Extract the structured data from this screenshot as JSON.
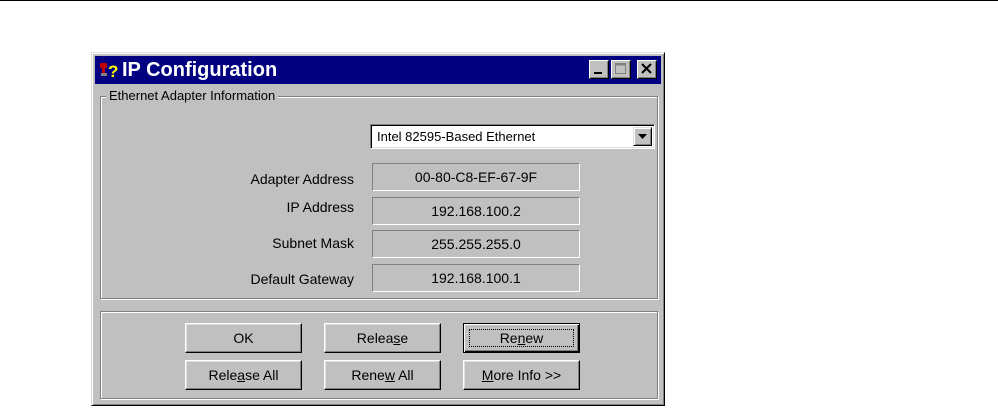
{
  "window": {
    "title": "IP Configuration"
  },
  "group": {
    "legend": "Ethernet  Adapter Information"
  },
  "adapter_select": {
    "selected": "Intel 82595-Based Ethernet"
  },
  "fields": {
    "adapter_address": {
      "label": "Adapter Address",
      "value": "00-80-C8-EF-67-9F"
    },
    "ip_address": {
      "label": "IP Address",
      "value": "192.168.100.2"
    },
    "subnet_mask": {
      "label": "Subnet Mask",
      "value": "255.255.255.0"
    },
    "default_gateway": {
      "label": "Default Gateway",
      "value": "192.168.100.1"
    }
  },
  "buttons": {
    "ok": {
      "label": "OK"
    },
    "release": {
      "before": "Relea",
      "mnemonic": "s",
      "after": "e"
    },
    "renew": {
      "before": "Re",
      "mnemonic": "n",
      "after": "ew"
    },
    "release_all": {
      "before": "Rele",
      "mnemonic": "a",
      "after": "se All"
    },
    "renew_all": {
      "before": "Rene",
      "mnemonic": "w",
      "after": " All"
    },
    "more_info": {
      "before": "",
      "mnemonic": "M",
      "after": "ore Info >>"
    }
  },
  "icons": {
    "app": "network-help-icon",
    "minimize": "minimize-icon",
    "maximize": "maximize-icon",
    "close": "close-icon",
    "dropdown": "chevron-down-icon"
  },
  "colors": {
    "titlebar": "#000080",
    "face": "#c0c0c0"
  }
}
